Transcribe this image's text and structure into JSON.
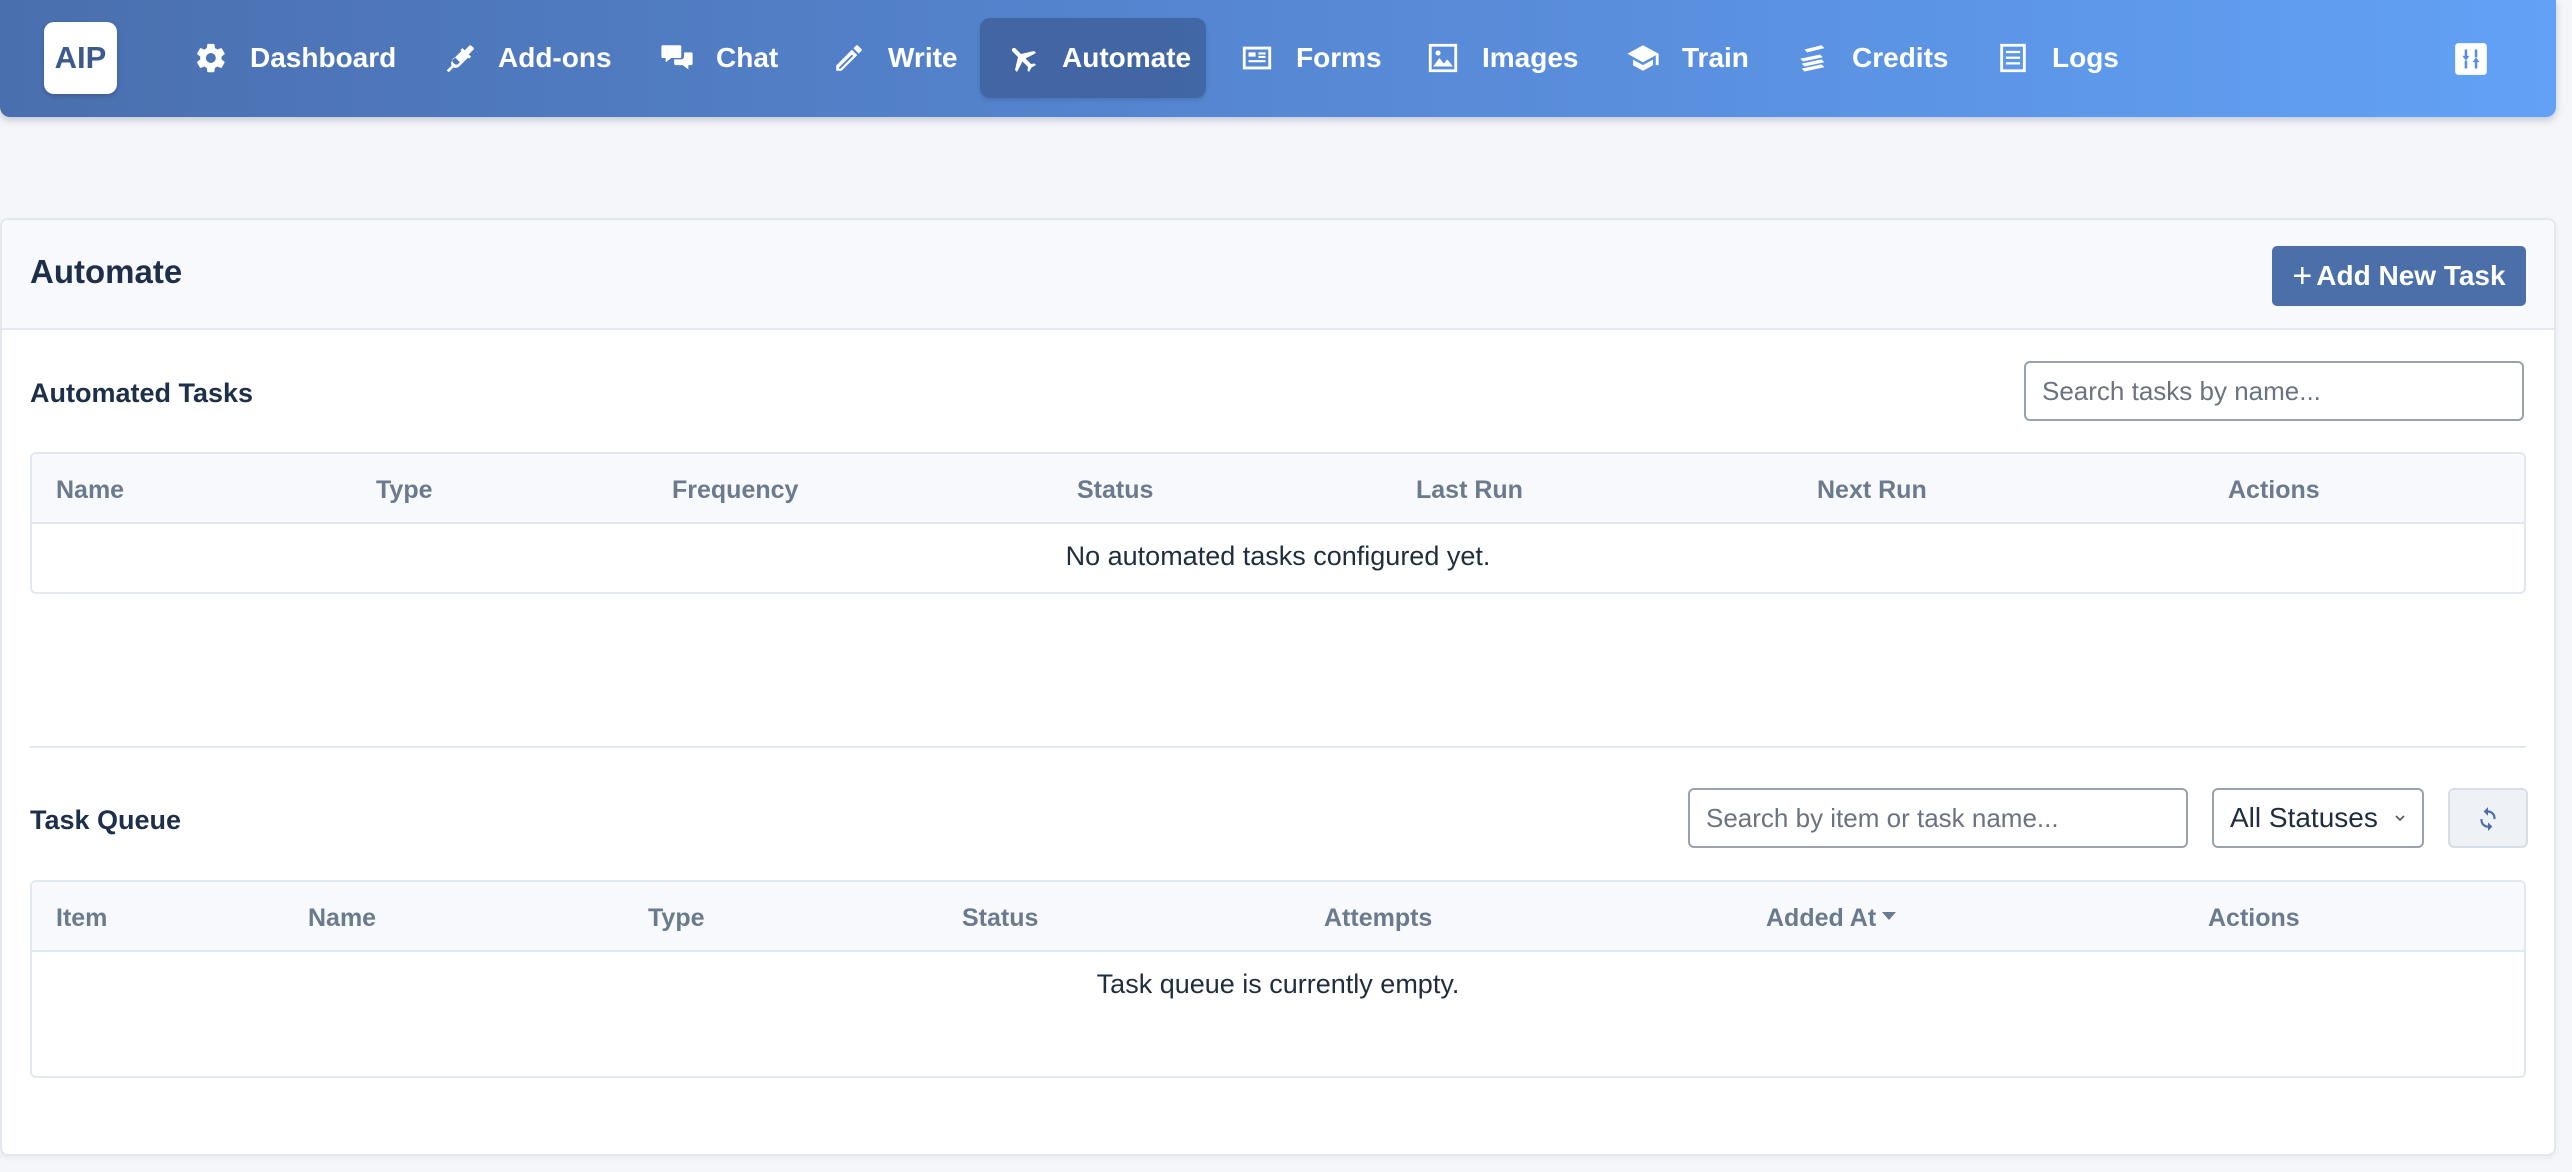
{
  "app": {
    "logo_text": "AIP"
  },
  "nav": {
    "items": [
      {
        "label": "Dashboard",
        "icon": "gear-icon"
      },
      {
        "label": "Add-ons",
        "icon": "plug-icon"
      },
      {
        "label": "Chat",
        "icon": "comments-icon"
      },
      {
        "label": "Write",
        "icon": "pencil-icon"
      },
      {
        "label": "Automate",
        "icon": "plane-icon",
        "active": true
      },
      {
        "label": "Forms",
        "icon": "form-icon"
      },
      {
        "label": "Images",
        "icon": "image-icon"
      },
      {
        "label": "Train",
        "icon": "graduation-cap-icon"
      },
      {
        "label": "Credits",
        "icon": "coins-icon"
      },
      {
        "label": "Logs",
        "icon": "list-icon"
      }
    ],
    "right_icon": "sliders-icon"
  },
  "page": {
    "title": "Automate",
    "add_button_label": "Add New Task"
  },
  "automated_tasks": {
    "title": "Automated Tasks",
    "search_placeholder": "Search tasks by name...",
    "columns": [
      "Name",
      "Type",
      "Frequency",
      "Status",
      "Last Run",
      "Next Run",
      "Actions"
    ],
    "rows": [],
    "empty_message": "No automated tasks configured yet."
  },
  "task_queue": {
    "title": "Task Queue",
    "search_placeholder": "Search by item or task name...",
    "status_filter": {
      "selected": "All Statuses"
    },
    "refresh_icon": "refresh-icon",
    "columns": [
      "Item",
      "Name",
      "Type",
      "Status",
      "Attempts",
      "Added At",
      "Actions"
    ],
    "sorted_column": "Added At",
    "sort_direction": "desc",
    "rows": [],
    "empty_message": "Task queue is currently empty."
  },
  "colors": {
    "navbar_start": "#4a6fae",
    "navbar_end": "#62a1f6",
    "primary_button": "#4a6fa9",
    "page_background": "#f4f6f9"
  }
}
